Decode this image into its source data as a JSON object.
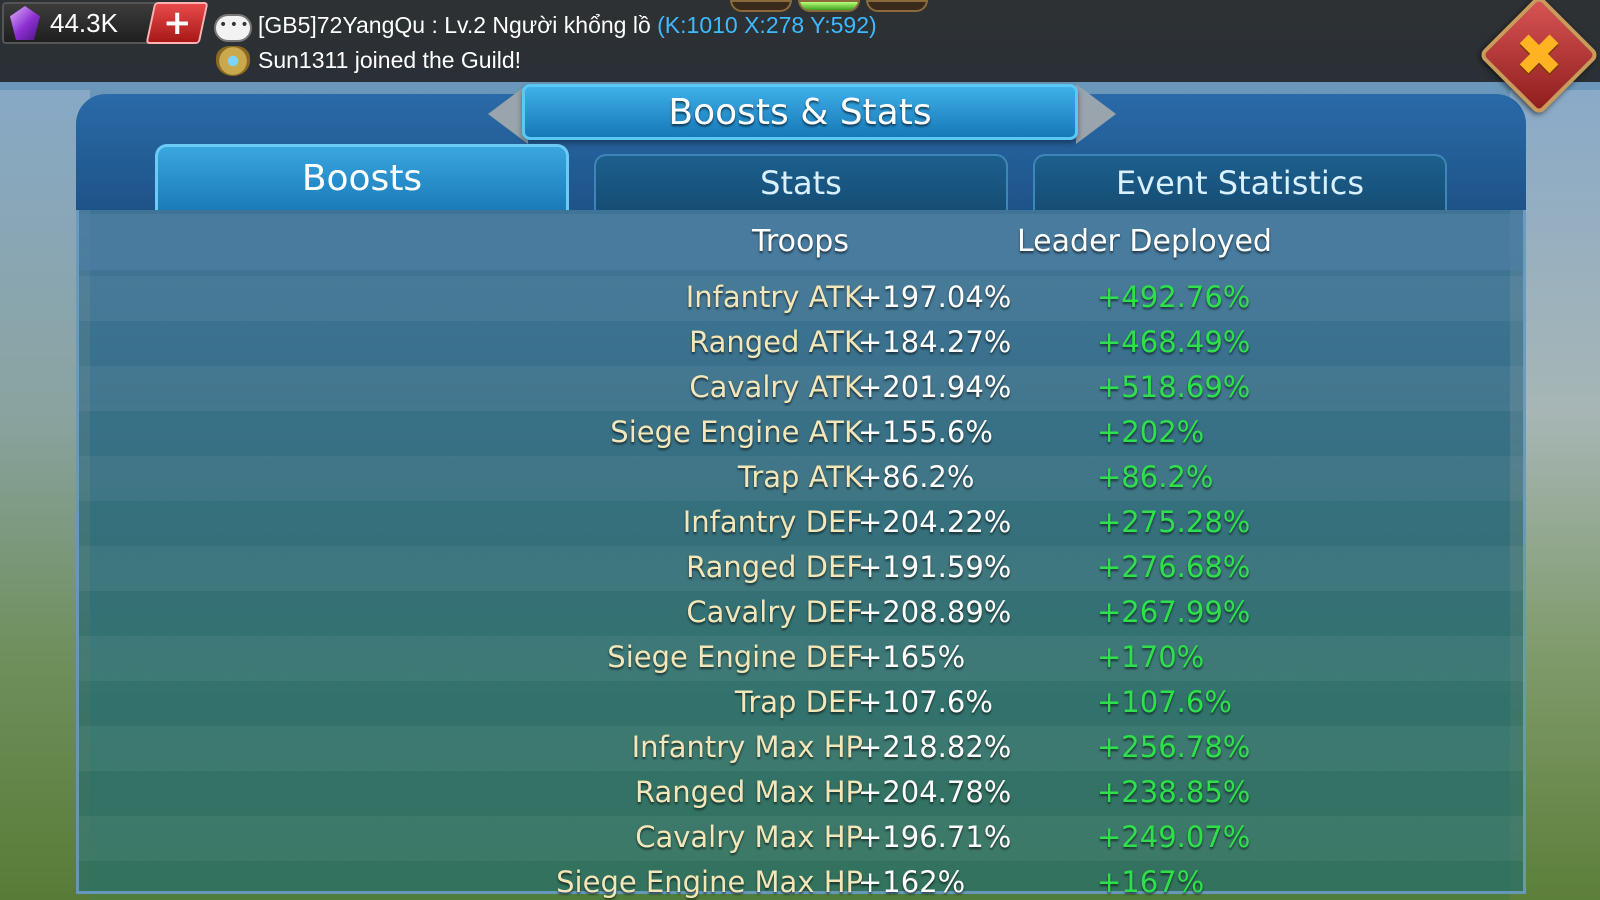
{
  "currency": {
    "gems": "44.3K",
    "add_label": "+",
    "icon": "gem-icon"
  },
  "chat": {
    "message_prefix": "[GB5]72YangQu : Lv.2 Người khổng lồ ",
    "message_coord": "(K:1010 X:278 Y:592)",
    "guild_message": "Sun1311 joined the Guild!"
  },
  "close_label": "✖",
  "header": {
    "title": "Boosts & Stats"
  },
  "tabs": [
    {
      "label": "Boosts",
      "active": true
    },
    {
      "label": "Stats",
      "active": false
    },
    {
      "label": "Event Statistics",
      "active": false
    }
  ],
  "table": {
    "columns": [
      "Troops",
      "Leader Deployed"
    ],
    "rows": [
      {
        "name": "Infantry ATK",
        "troops": "+197.04%",
        "leader": "+492.76%"
      },
      {
        "name": "Ranged ATK",
        "troops": "+184.27%",
        "leader": "+468.49%"
      },
      {
        "name": "Cavalry ATK",
        "troops": "+201.94%",
        "leader": "+518.69%"
      },
      {
        "name": "Siege Engine ATK",
        "troops": "+155.6%",
        "leader": "+202%"
      },
      {
        "name": "Trap ATK",
        "troops": "+86.2%",
        "leader": "+86.2%"
      },
      {
        "name": "Infantry DEF",
        "troops": "+204.22%",
        "leader": "+275.28%"
      },
      {
        "name": "Ranged DEF",
        "troops": "+191.59%",
        "leader": "+276.68%"
      },
      {
        "name": "Cavalry DEF",
        "troops": "+208.89%",
        "leader": "+267.99%"
      },
      {
        "name": "Siege Engine DEF",
        "troops": "+165%",
        "leader": "+170%"
      },
      {
        "name": "Trap DEF",
        "troops": "+107.6%",
        "leader": "+107.6%"
      },
      {
        "name": "Infantry Max HP",
        "troops": "+218.82%",
        "leader": "+256.78%"
      },
      {
        "name": "Ranged Max HP",
        "troops": "+204.78%",
        "leader": "+238.85%"
      },
      {
        "name": "Cavalry Max HP",
        "troops": "+196.71%",
        "leader": "+249.07%"
      },
      {
        "name": "Siege Engine Max HP",
        "troops": "+162%",
        "leader": "+167%"
      }
    ]
  },
  "colors": {
    "troops_value": "#ffffff",
    "leader_value": "#2ee04a",
    "stat_label": "#f3e6b8",
    "coord_link": "#3fb9ff"
  }
}
